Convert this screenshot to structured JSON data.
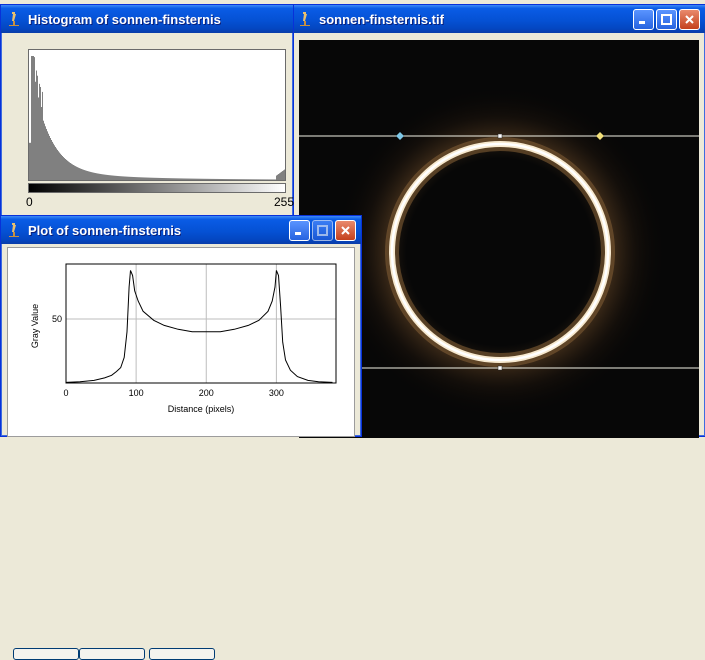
{
  "image_window": {
    "title": "sonnen-finsternis.tif"
  },
  "histogram_window": {
    "title": "Histogram of sonnen-finsternis",
    "axis_min": "0",
    "axis_max": "255"
  },
  "plot_window": {
    "title": "Plot of sonnen-finsternis"
  },
  "chart_data": {
    "type": "line",
    "title": "",
    "xlabel": "Distance (pixels)",
    "ylabel": "Gray Value",
    "xlim": [
      0,
      385
    ],
    "ylim": [
      0,
      93
    ],
    "xticks": [
      0,
      100,
      200,
      300
    ],
    "yticks": [
      50
    ],
    "grid": true,
    "x": [
      0,
      20,
      40,
      55,
      65,
      72,
      78,
      83,
      87,
      90,
      92,
      95,
      98,
      103,
      110,
      125,
      140,
      160,
      180,
      200,
      220,
      240,
      260,
      275,
      288,
      294,
      298,
      300,
      303,
      306,
      309,
      313,
      320,
      330,
      345,
      360,
      380
    ],
    "y": [
      0.5,
      1,
      2,
      4,
      6,
      9,
      12,
      20,
      40,
      75,
      88,
      84,
      72,
      64,
      56,
      49,
      45,
      42,
      40,
      40,
      40,
      42,
      45,
      49,
      56,
      64,
      75,
      88,
      84,
      60,
      32,
      18,
      10,
      5,
      2,
      1,
      0.5
    ]
  },
  "colors": {
    "title_bar": "#0551d4",
    "frame": "#ece9d8",
    "close_button": "#c4401d",
    "image_background": "#070707",
    "ring": "#f4e4c6"
  },
  "icons": [
    "microscope-icon",
    "minimize-icon",
    "maximize-icon",
    "close-icon"
  ]
}
